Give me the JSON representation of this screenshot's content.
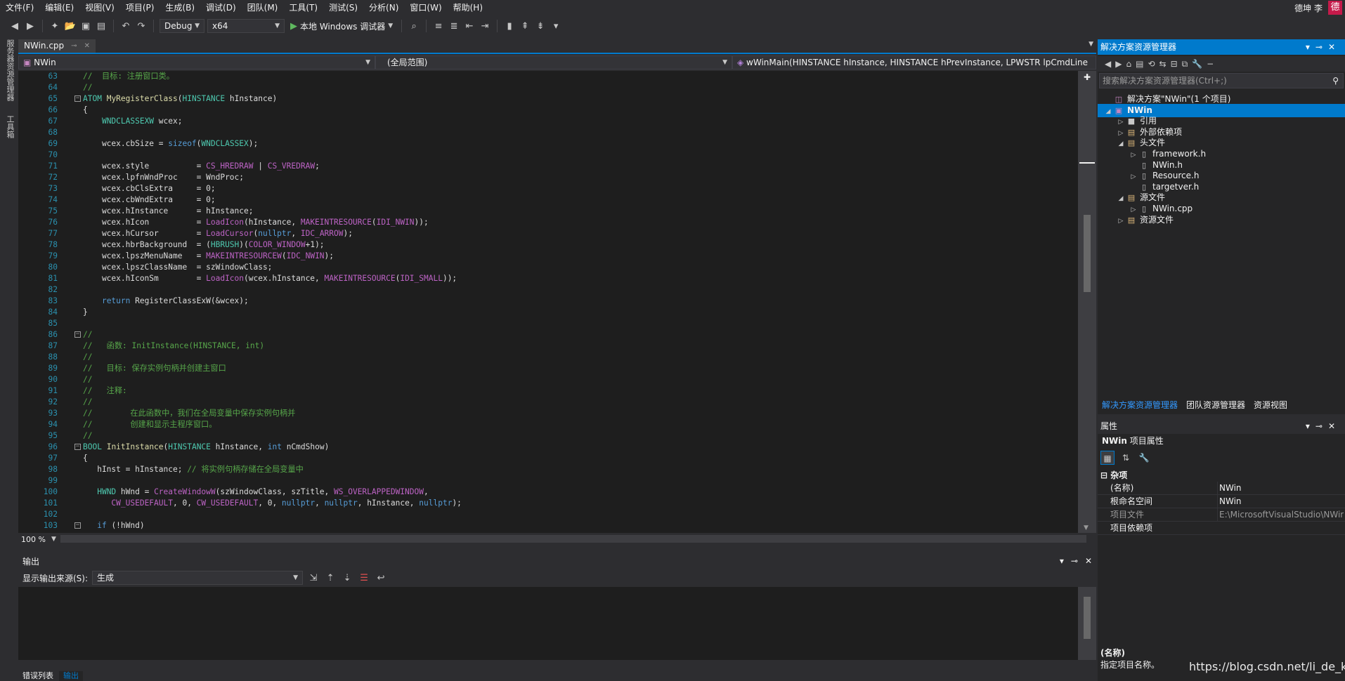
{
  "menubar": {
    "items": [
      "文件(F)",
      "编辑(E)",
      "视图(V)",
      "项目(P)",
      "生成(B)",
      "调试(D)",
      "团队(M)",
      "工具(T)",
      "测试(S)",
      "分析(N)",
      "窗口(W)",
      "帮助(H)"
    ],
    "user": "德坤 李",
    "avatar": "德"
  },
  "toolbar": {
    "config": "Debug",
    "platform": "x64",
    "run_label": "本地 Windows 调试器"
  },
  "left_strip": {
    "server_explorer": "服务器资源管理器",
    "toolbox": "工具箱"
  },
  "editor": {
    "tab_title": "NWin.cpp",
    "nav_project": "NWin",
    "nav_scope": "(全局范围)",
    "nav_function": "wWinMain(HINSTANCE hInstance, HINSTANCE hPrevInstance, LPWSTR lpCmdLine",
    "zoom": "100 %",
    "lines": [
      {
        "n": "63",
        "parts": [
          [
            "cm",
            "//  目标: 注册窗口类。"
          ]
        ]
      },
      {
        "n": "64",
        "parts": [
          [
            "cm",
            "//"
          ]
        ]
      },
      {
        "n": "65",
        "fold": "−",
        "parts": [
          [
            "ty",
            "ATOM"
          ],
          [
            "def",
            " "
          ],
          [
            "fn",
            "MyRegisterClass"
          ],
          [
            "def",
            "("
          ],
          [
            "ty",
            "HINSTANCE"
          ],
          [
            "def",
            " hInstance)"
          ]
        ]
      },
      {
        "n": "66",
        "parts": [
          [
            "def",
            "{"
          ]
        ]
      },
      {
        "n": "67",
        "parts": [
          [
            "def",
            "    "
          ],
          [
            "ty",
            "WNDCLASSEXW"
          ],
          [
            "def",
            " wcex;"
          ]
        ]
      },
      {
        "n": "68",
        "parts": [
          [
            "def",
            ""
          ]
        ]
      },
      {
        "n": "69",
        "parts": [
          [
            "def",
            "    wcex.cbSize = "
          ],
          [
            "kw",
            "sizeof"
          ],
          [
            "def",
            "("
          ],
          [
            "ty",
            "WNDCLASSEX"
          ],
          [
            "def",
            ");"
          ]
        ]
      },
      {
        "n": "70",
        "parts": [
          [
            "def",
            ""
          ]
        ]
      },
      {
        "n": "71",
        "parts": [
          [
            "def",
            "    wcex.style          = "
          ],
          [
            "mac",
            "CS_HREDRAW"
          ],
          [
            "def",
            " | "
          ],
          [
            "mac",
            "CS_VREDRAW"
          ],
          [
            "def",
            ";"
          ]
        ]
      },
      {
        "n": "72",
        "parts": [
          [
            "def",
            "    wcex.lpfnWndProc    = WndProc;"
          ]
        ]
      },
      {
        "n": "73",
        "parts": [
          [
            "def",
            "    wcex.cbClsExtra     = 0;"
          ]
        ]
      },
      {
        "n": "74",
        "parts": [
          [
            "def",
            "    wcex.cbWndExtra     = 0;"
          ]
        ]
      },
      {
        "n": "75",
        "parts": [
          [
            "def",
            "    wcex.hInstance      = hInstance;"
          ]
        ]
      },
      {
        "n": "76",
        "parts": [
          [
            "def",
            "    wcex.hIcon          = "
          ],
          [
            "mac",
            "LoadIcon"
          ],
          [
            "def",
            "(hInstance, "
          ],
          [
            "mac",
            "MAKEINTRESOURCE"
          ],
          [
            "def",
            "("
          ],
          [
            "mac",
            "IDI_NWIN"
          ],
          [
            "def",
            "));"
          ]
        ]
      },
      {
        "n": "77",
        "parts": [
          [
            "def",
            "    wcex.hCursor        = "
          ],
          [
            "mac",
            "LoadCursor"
          ],
          [
            "def",
            "("
          ],
          [
            "kw",
            "nullptr"
          ],
          [
            "def",
            ", "
          ],
          [
            "mac",
            "IDC_ARROW"
          ],
          [
            "def",
            ");"
          ]
        ]
      },
      {
        "n": "78",
        "parts": [
          [
            "def",
            "    wcex.hbrBackground  = ("
          ],
          [
            "ty",
            "HBRUSH"
          ],
          [
            "def",
            ")("
          ],
          [
            "mac",
            "COLOR_WINDOW"
          ],
          [
            "def",
            "+1);"
          ]
        ]
      },
      {
        "n": "79",
        "parts": [
          [
            "def",
            "    wcex.lpszMenuName   = "
          ],
          [
            "mac",
            "MAKEINTRESOURCEW"
          ],
          [
            "def",
            "("
          ],
          [
            "mac",
            "IDC_NWIN"
          ],
          [
            "def",
            ");"
          ]
        ]
      },
      {
        "n": "80",
        "parts": [
          [
            "def",
            "    wcex.lpszClassName  = szWindowClass;"
          ]
        ]
      },
      {
        "n": "81",
        "parts": [
          [
            "def",
            "    wcex.hIconSm        = "
          ],
          [
            "mac",
            "LoadIcon"
          ],
          [
            "def",
            "(wcex.hInstance, "
          ],
          [
            "mac",
            "MAKEINTRESOURCE"
          ],
          [
            "def",
            "("
          ],
          [
            "mac",
            "IDI_SMALL"
          ],
          [
            "def",
            "));"
          ]
        ]
      },
      {
        "n": "82",
        "parts": [
          [
            "def",
            ""
          ]
        ]
      },
      {
        "n": "83",
        "parts": [
          [
            "def",
            "    "
          ],
          [
            "kw",
            "return"
          ],
          [
            "def",
            " RegisterClassExW(&wcex);"
          ]
        ]
      },
      {
        "n": "84",
        "parts": [
          [
            "def",
            "}"
          ]
        ]
      },
      {
        "n": "85",
        "parts": [
          [
            "def",
            ""
          ]
        ]
      },
      {
        "n": "86",
        "fold": "−",
        "parts": [
          [
            "cm",
            "//"
          ]
        ]
      },
      {
        "n": "87",
        "parts": [
          [
            "cm",
            "//   函数: InitInstance(HINSTANCE, int)"
          ]
        ]
      },
      {
        "n": "88",
        "parts": [
          [
            "cm",
            "//"
          ]
        ]
      },
      {
        "n": "89",
        "parts": [
          [
            "cm",
            "//   目标: 保存实例句柄并创建主窗口"
          ]
        ]
      },
      {
        "n": "90",
        "parts": [
          [
            "cm",
            "//"
          ]
        ]
      },
      {
        "n": "91",
        "parts": [
          [
            "cm",
            "//   注释:"
          ]
        ]
      },
      {
        "n": "92",
        "parts": [
          [
            "cm",
            "//"
          ]
        ]
      },
      {
        "n": "93",
        "parts": [
          [
            "cm",
            "//        在此函数中，我们在全局变量中保存实例句柄并"
          ]
        ]
      },
      {
        "n": "94",
        "parts": [
          [
            "cm",
            "//        创建和显示主程序窗口。"
          ]
        ]
      },
      {
        "n": "95",
        "parts": [
          [
            "cm",
            "//"
          ]
        ]
      },
      {
        "n": "96",
        "fold": "−",
        "parts": [
          [
            "ty",
            "BOOL"
          ],
          [
            "def",
            " "
          ],
          [
            "fn",
            "InitInstance"
          ],
          [
            "def",
            "("
          ],
          [
            "ty",
            "HINSTANCE"
          ],
          [
            "def",
            " hInstance, "
          ],
          [
            "kw",
            "int"
          ],
          [
            "def",
            " nCmdShow)"
          ]
        ]
      },
      {
        "n": "97",
        "parts": [
          [
            "def",
            "{"
          ]
        ]
      },
      {
        "n": "98",
        "parts": [
          [
            "def",
            "   hInst = hInstance; "
          ],
          [
            "cm",
            "// 将实例句柄存储在全局变量中"
          ]
        ]
      },
      {
        "n": "99",
        "parts": [
          [
            "def",
            ""
          ]
        ]
      },
      {
        "n": "100",
        "parts": [
          [
            "def",
            "   "
          ],
          [
            "ty",
            "HWND"
          ],
          [
            "def",
            " hWnd = "
          ],
          [
            "mac",
            "CreateWindowW"
          ],
          [
            "def",
            "(szWindowClass, szTitle, "
          ],
          [
            "mac",
            "WS_OVERLAPPEDWINDOW"
          ],
          [
            "def",
            ","
          ]
        ]
      },
      {
        "n": "101",
        "parts": [
          [
            "def",
            "      "
          ],
          [
            "mac",
            "CW_USEDEFAULT"
          ],
          [
            "def",
            ", 0, "
          ],
          [
            "mac",
            "CW_USEDEFAULT"
          ],
          [
            "def",
            ", 0, "
          ],
          [
            "kw",
            "nullptr"
          ],
          [
            "def",
            ", "
          ],
          [
            "kw",
            "nullptr"
          ],
          [
            "def",
            ", hInstance, "
          ],
          [
            "kw",
            "nullptr"
          ],
          [
            "def",
            ");"
          ]
        ]
      },
      {
        "n": "102",
        "parts": [
          [
            "def",
            ""
          ]
        ]
      },
      {
        "n": "103",
        "fold": "−",
        "parts": [
          [
            "def",
            "   "
          ],
          [
            "kw",
            "if"
          ],
          [
            "def",
            " (!hWnd)"
          ]
        ]
      }
    ]
  },
  "output": {
    "title": "输出",
    "source_label": "显示输出来源(S):",
    "source_value": "生成",
    "bottom_tabs": [
      "错误列表",
      "输出"
    ]
  },
  "solution_explorer": {
    "title": "解决方案资源管理器",
    "search_placeholder": "搜索解决方案资源管理器(Ctrl+;)",
    "items": [
      {
        "label": "解决方案\"NWin\"(1 个项目)",
        "indent": 0,
        "tri": "",
        "icon": "solution-icon",
        "glyph": "◫",
        "cls": "proj"
      },
      {
        "label": "NWin",
        "indent": 0,
        "tri": "◢",
        "icon": "project-icon",
        "glyph": "▣",
        "cls": "proj",
        "selected": true
      },
      {
        "label": "引用",
        "indent": 1,
        "tri": "▷",
        "icon": "references-icon",
        "glyph": "■",
        "cls": "file"
      },
      {
        "label": "外部依赖项",
        "indent": 1,
        "tri": "▷",
        "icon": "folder-icon",
        "glyph": "▤",
        "cls": "folder"
      },
      {
        "label": "头文件",
        "indent": 1,
        "tri": "◢",
        "icon": "folder-icon",
        "glyph": "▤",
        "cls": "folder"
      },
      {
        "label": "framework.h",
        "indent": 2,
        "tri": "▷",
        "icon": "header-file-icon",
        "glyph": "▯",
        "cls": "file"
      },
      {
        "label": "NWin.h",
        "indent": 2,
        "tri": "",
        "icon": "header-file-icon",
        "glyph": "▯",
        "cls": "file"
      },
      {
        "label": "Resource.h",
        "indent": 2,
        "tri": "▷",
        "icon": "header-file-icon",
        "glyph": "▯",
        "cls": "file"
      },
      {
        "label": "targetver.h",
        "indent": 2,
        "tri": "",
        "icon": "header-file-icon",
        "glyph": "▯",
        "cls": "file"
      },
      {
        "label": "源文件",
        "indent": 1,
        "tri": "◢",
        "icon": "folder-icon",
        "glyph": "▤",
        "cls": "folder"
      },
      {
        "label": "NWin.cpp",
        "indent": 2,
        "tri": "▷",
        "icon": "cpp-file-icon",
        "glyph": "▯",
        "cls": "file"
      },
      {
        "label": "资源文件",
        "indent": 1,
        "tri": "▷",
        "icon": "folder-icon",
        "glyph": "▤",
        "cls": "folder"
      }
    ],
    "tabs": [
      "解决方案资源管理器",
      "团队资源管理器",
      "资源视图"
    ]
  },
  "properties": {
    "title": "属性",
    "selected_name": "NWin",
    "selected_kind": "项目属性",
    "category": "杂项",
    "rows": [
      {
        "name": "(名称)",
        "value": "NWin",
        "dim": false
      },
      {
        "name": "根命名空间",
        "value": "NWin",
        "dim": false
      },
      {
        "name": "项目文件",
        "value": "E:\\MicrosoftVisualStudio\\NWin",
        "dim": true
      },
      {
        "name": "项目依赖项",
        "value": "",
        "dim": false
      }
    ],
    "desc_title": "(名称)",
    "desc_text": "指定项目名称。"
  },
  "watermark": "https://blog.csdn.net/li_de_kun",
  "colors": {
    "accent": "#007acc",
    "background": "#2d2d30",
    "editor_bg": "#1e1e1e"
  }
}
